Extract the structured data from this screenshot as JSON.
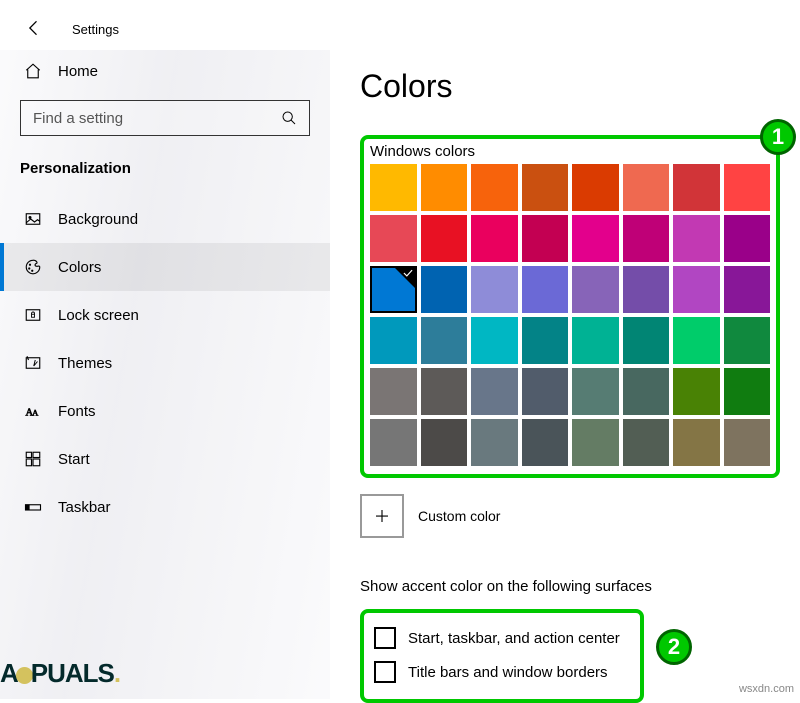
{
  "header": {
    "title": "Settings"
  },
  "sidebar": {
    "home_label": "Home",
    "search_placeholder": "Find a setting",
    "category": "Personalization",
    "items": [
      {
        "label": "Background",
        "icon": "image-icon"
      },
      {
        "label": "Colors",
        "icon": "palette-icon",
        "active": true
      },
      {
        "label": "Lock screen",
        "icon": "lock-screen-icon"
      },
      {
        "label": "Themes",
        "icon": "themes-icon"
      },
      {
        "label": "Fonts",
        "icon": "fonts-icon"
      },
      {
        "label": "Start",
        "icon": "start-icon"
      },
      {
        "label": "Taskbar",
        "icon": "taskbar-icon"
      }
    ]
  },
  "content": {
    "page_title": "Colors",
    "windows_colors_label": "Windows colors",
    "colors": [
      [
        "#FFB900",
        "#FF8C00",
        "#F7630C",
        "#CA5010",
        "#DA3B01",
        "#EF6950",
        "#D13438",
        "#FF4343"
      ],
      [
        "#E74856",
        "#E81123",
        "#EA005E",
        "#C30052",
        "#E3008C",
        "#BF0077",
        "#C239B3",
        "#9A0089"
      ],
      [
        "#0078D4",
        "#0063B1",
        "#8E8CD8",
        "#6B69D6",
        "#8764B8",
        "#744DA9",
        "#B146C2",
        "#881798"
      ],
      [
        "#0099BC",
        "#2D7D9A",
        "#00B7C3",
        "#038387",
        "#00B294",
        "#018574",
        "#00CC6A",
        "#10893E"
      ],
      [
        "#7A7574",
        "#5D5A58",
        "#68768A",
        "#515C6B",
        "#567C73",
        "#486860",
        "#498205",
        "#107C10"
      ],
      [
        "#767676",
        "#4C4A48",
        "#69797E",
        "#4A5459",
        "#647C64",
        "#525E54",
        "#847545",
        "#7E735F"
      ]
    ],
    "selected_color": {
      "row": 2,
      "col": 0
    },
    "custom_color_label": "Custom color",
    "surfaces_heading": "Show accent color on the following surfaces",
    "checkboxes": [
      {
        "label": "Start, taskbar, and action center",
        "checked": false
      },
      {
        "label": "Title bars and window borders",
        "checked": false
      }
    ]
  },
  "annotations": {
    "callout1": "1",
    "callout2": "2"
  },
  "watermark": "wsxdn.com"
}
